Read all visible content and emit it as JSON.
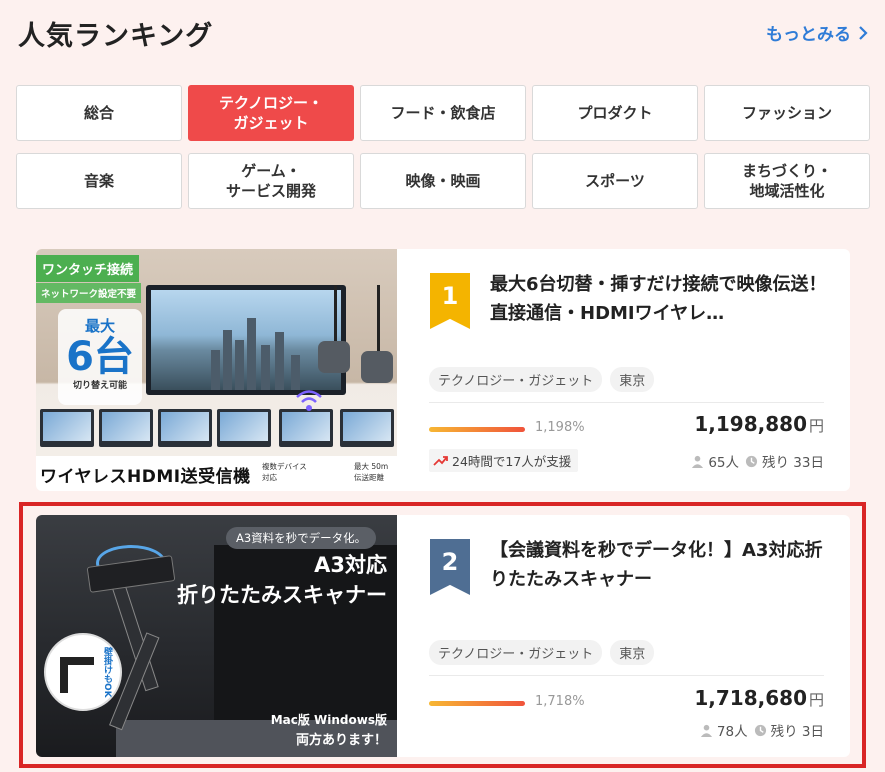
{
  "header": {
    "title": "人気ランキング",
    "more_label": "もっとみる"
  },
  "categories": [
    {
      "label": "総合",
      "active": false
    },
    {
      "label": "テクノロジー・\nガジェット",
      "active": true
    },
    {
      "label": "フード・飲食店",
      "active": false
    },
    {
      "label": "プロダクト",
      "active": false
    },
    {
      "label": "ファッション",
      "active": false
    },
    {
      "label": "音楽",
      "active": false
    },
    {
      "label": "ゲーム・\nサービス開発",
      "active": false
    },
    {
      "label": "映像・映画",
      "active": false
    },
    {
      "label": "スポーツ",
      "active": false
    },
    {
      "label": "まちづくり・\n地域活性化",
      "active": false
    }
  ],
  "items": [
    {
      "rank": "1",
      "title": "最大6台切替・挿すだけ接続で映像伝送！直接通信・HDMIワイヤレ…",
      "tags": [
        "テクノロジー・ガジェット",
        "東京"
      ],
      "percent": "1,198%",
      "progress": 1.0,
      "amount": "1,198,880",
      "currency": "円",
      "trend": "24時間で17人が支援",
      "supporters": "65人",
      "remaining": "残り 33日",
      "thumb": {
        "badge1": "ワンタッチ接続",
        "badge2": "ネットワーク設定不要",
        "max": "最大",
        "six": "6台",
        "switch": "切り替え可能",
        "banner": "ワイヤレスHDMI送受信機",
        "sub1_l1": "複数デバイス",
        "sub1_l2": "対応",
        "sub2_l1": "最大 50m",
        "sub2_l2": "伝送距離"
      }
    },
    {
      "rank": "2",
      "title": "【会議資料を秒でデータ化！】A3対応折りたたみスキャナー",
      "tags": [
        "テクノロジー・ガジェット",
        "東京"
      ],
      "percent": "1,718%",
      "progress": 1.0,
      "amount": "1,718,680",
      "currency": "円",
      "supporters": "78人",
      "remaining": "残り 3日",
      "thumb": {
        "pill": "A3資料を秒でデータ化。",
        "line1": "A3対応",
        "line2": "折りたたみスキャナー",
        "wall": "壁掛けもOK",
        "os": "Mac版 Windows版",
        "both": "両方あります！"
      }
    }
  ],
  "colors": {
    "accent": "#ef4a4a",
    "link": "#2f7cd7",
    "rank1": "#f4b400",
    "rank2": "#4f6e93",
    "highlight": "#d92626"
  }
}
